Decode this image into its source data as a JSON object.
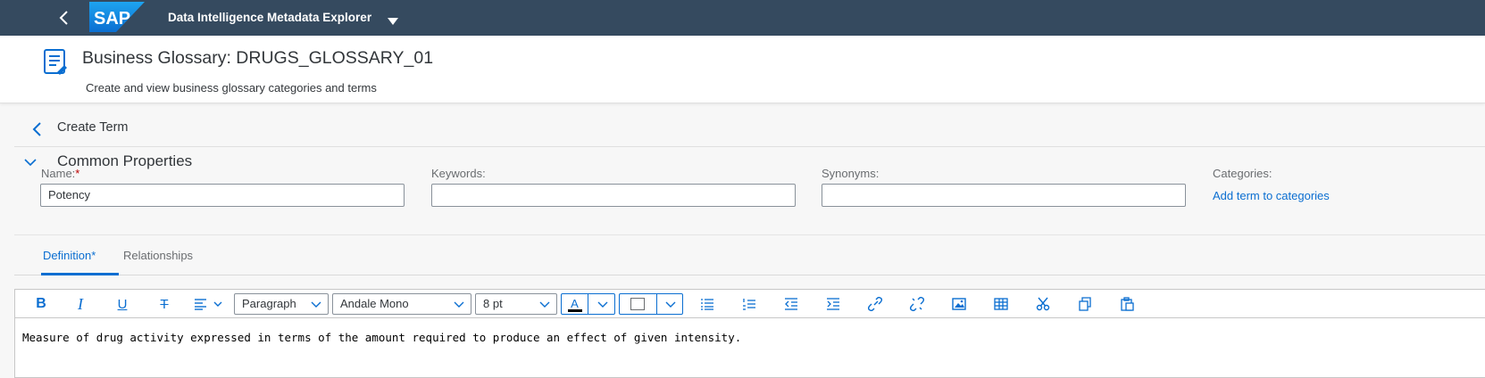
{
  "shell": {
    "logo_text": "SAP",
    "app_title": "Data Intelligence Metadata Explorer",
    "back_icon": "back-arrow-icon",
    "menu_icon": "caret-down-icon"
  },
  "header": {
    "title": "Business Glossary: DRUGS_GLOSSARY_01",
    "subtitle": "Create and view business glossary categories and terms",
    "icon": "glossary-icon"
  },
  "crumb": {
    "label": "Create Term"
  },
  "common_properties": {
    "title": "Common Properties",
    "name_label": "Name:",
    "name_required": "*",
    "name_value": "Potency",
    "keywords_label": "Keywords:",
    "keywords_value": "",
    "synonyms_label": "Synonyms:",
    "synonyms_value": "",
    "categories_label": "Categories:",
    "categories_link": "Add term to categories"
  },
  "tabs": [
    {
      "label": "Definition*",
      "active": true
    },
    {
      "label": "Relationships",
      "active": false
    }
  ],
  "editor": {
    "toolbar": {
      "paragraph": "Paragraph",
      "font": "Andale Mono",
      "size": "8 pt",
      "text_color_glyph": "A"
    },
    "content": "Measure of drug activity expressed in terms of the amount required to produce an effect of given intensity."
  },
  "colors": {
    "shell": "#354a5f",
    "accent": "#0a6ed1",
    "required": "#bb0000"
  }
}
